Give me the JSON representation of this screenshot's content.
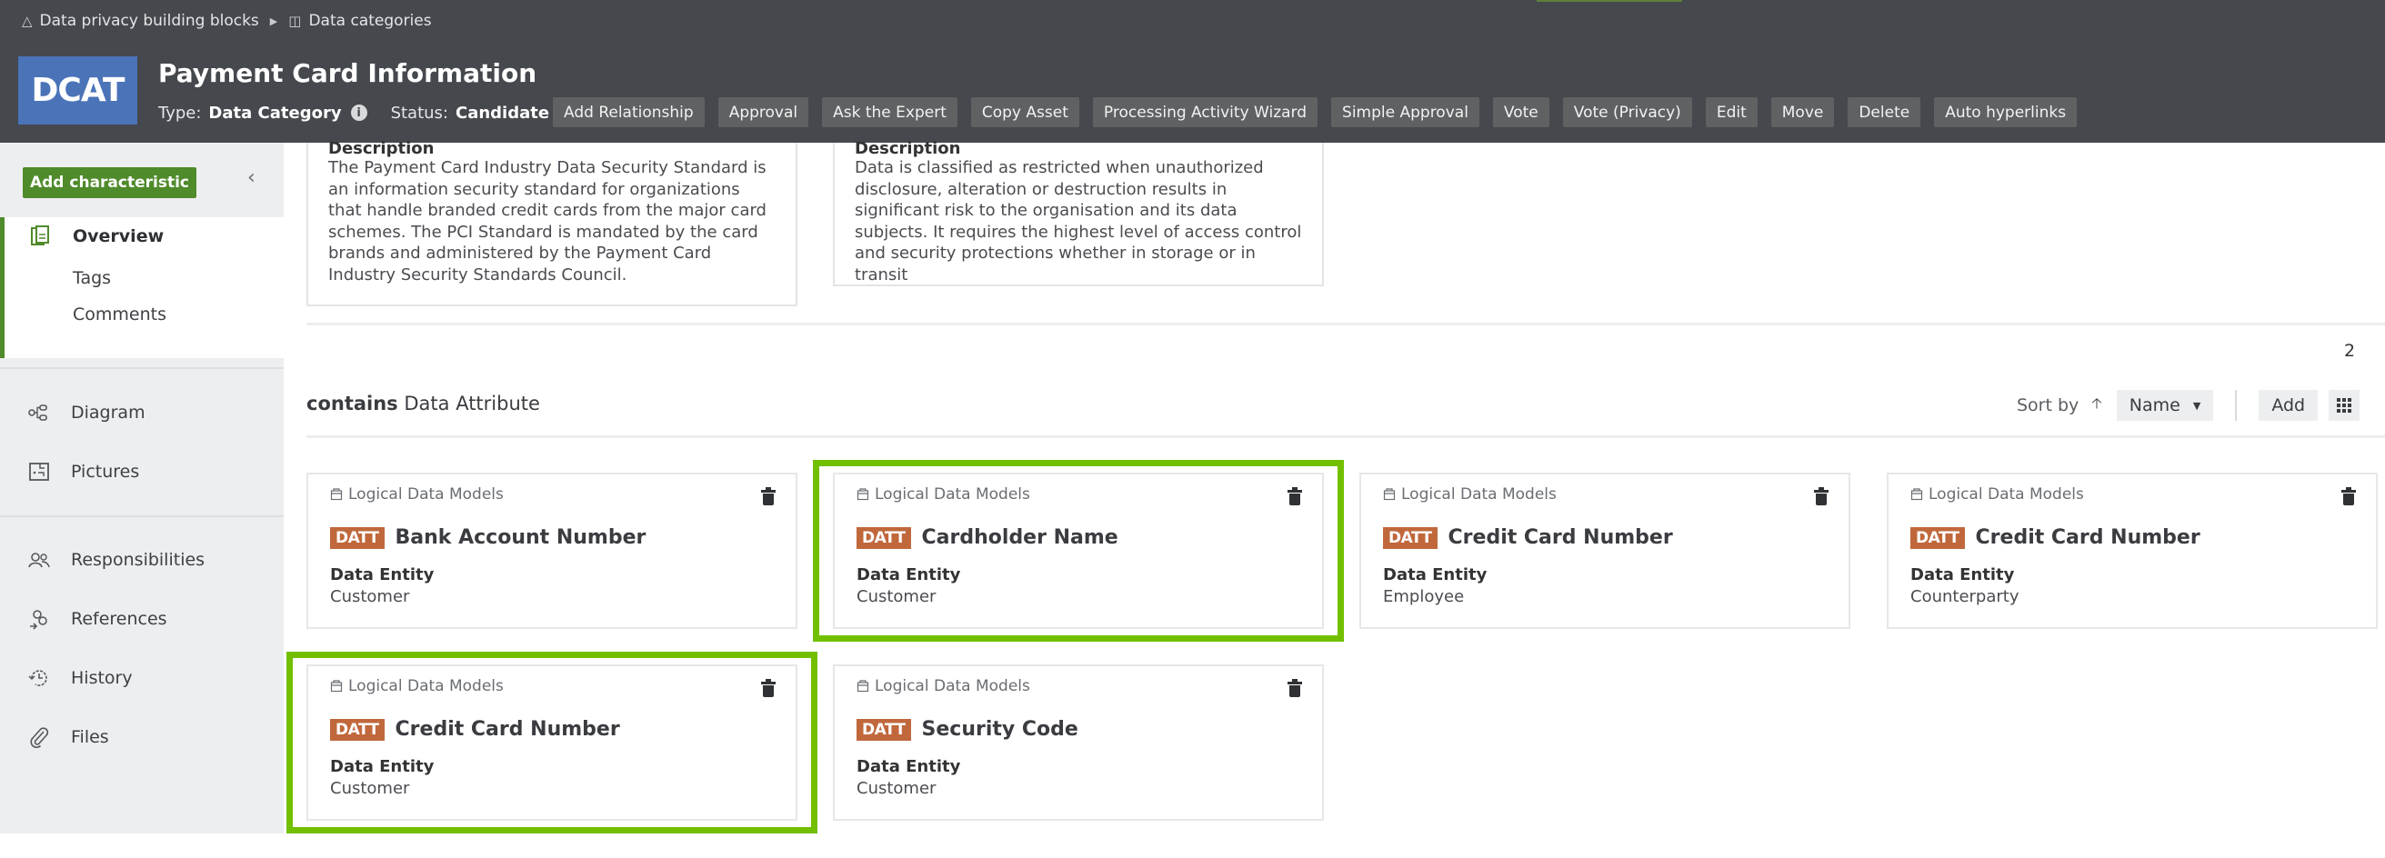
{
  "breadcrumb": [
    {
      "icon": "building-blocks-icon",
      "label": "Data privacy building blocks"
    },
    {
      "icon": "data-category-icon",
      "label": "Data categories"
    }
  ],
  "asset": {
    "badge": "DCAT",
    "title": "Payment Card Information",
    "type_label": "Type:",
    "type_value": "Data Category",
    "status_label": "Status:",
    "status_value": "Candidate"
  },
  "actions": [
    "Add Relationship",
    "Approval",
    "Ask the Expert",
    "Copy Asset",
    "Processing Activity Wizard",
    "Simple Approval",
    "Vote",
    "Vote (Privacy)",
    "Edit",
    "Move",
    "Delete",
    "Auto hyperlinks"
  ],
  "sidebar": {
    "add_characteristic": "Add characteristic",
    "collapse_icon": "chevron-left-icon",
    "overview": {
      "label": "Overview",
      "icon": "overview-icon",
      "subitems": [
        "Tags",
        "Comments"
      ]
    },
    "group2": [
      {
        "label": "Diagram",
        "icon": "diagram-icon"
      },
      {
        "label": "Pictures",
        "icon": "pictures-icon"
      }
    ],
    "group3": [
      {
        "label": "Responsibilities",
        "icon": "people-icon"
      },
      {
        "label": "References",
        "icon": "references-icon"
      },
      {
        "label": "History",
        "icon": "history-icon"
      },
      {
        "label": "Files",
        "icon": "paperclip-icon"
      }
    ]
  },
  "descriptions": [
    {
      "heading": "Description",
      "text": "The Payment Card Industry Data Security Standard is an information security standard for organizations that handle branded credit cards from the major card schemes. The PCI Standard is mandated by the card brands and administered by the Payment Card Industry Security Standards Council."
    },
    {
      "heading": "Description",
      "text": "Data is classified as restricted when unauthorized disclosure, alteration or destruction results in significant risk to the organisation and its data subjects. It requires the highest level of access control and security protections whether  in storage or in transit"
    }
  ],
  "relation_section": {
    "count": "2",
    "relation": "contains",
    "target": "Data Attribute",
    "sort_label": "Sort by",
    "sort_value": "Name",
    "add_label": "Add",
    "view_icon": "grid-icon"
  },
  "cards": [
    {
      "domain": "Logical Data Models",
      "badge": "DATT",
      "name": "Bank Account Number",
      "entity_label": "Data Entity",
      "entity_value": "Customer",
      "highlighted": false
    },
    {
      "domain": "Logical Data Models",
      "badge": "DATT",
      "name": "Cardholder Name",
      "entity_label": "Data Entity",
      "entity_value": "Customer",
      "highlighted": true
    },
    {
      "domain": "Logical Data Models",
      "badge": "DATT",
      "name": "Credit Card Number",
      "entity_label": "Data Entity",
      "entity_value": "Employee",
      "highlighted": false
    },
    {
      "domain": "Logical Data Models",
      "badge": "DATT",
      "name": "Credit Card Number",
      "entity_label": "Data Entity",
      "entity_value": "Counterparty",
      "highlighted": false
    },
    {
      "domain": "Logical Data Models",
      "badge": "DATT",
      "name": "Credit Card Number",
      "entity_label": "Data Entity",
      "entity_value": "Customer",
      "highlighted": true
    },
    {
      "domain": "Logical Data Models",
      "badge": "DATT",
      "name": "Security Code",
      "entity_label": "Data Entity",
      "entity_value": "Customer",
      "highlighted": false
    }
  ],
  "colors": {
    "header_bg": "#45484d",
    "asset_badge": "#4a73b8",
    "primary_green": "#4f8a2b",
    "datt_badge": "#c0683c",
    "highlight": "#72bf00"
  }
}
